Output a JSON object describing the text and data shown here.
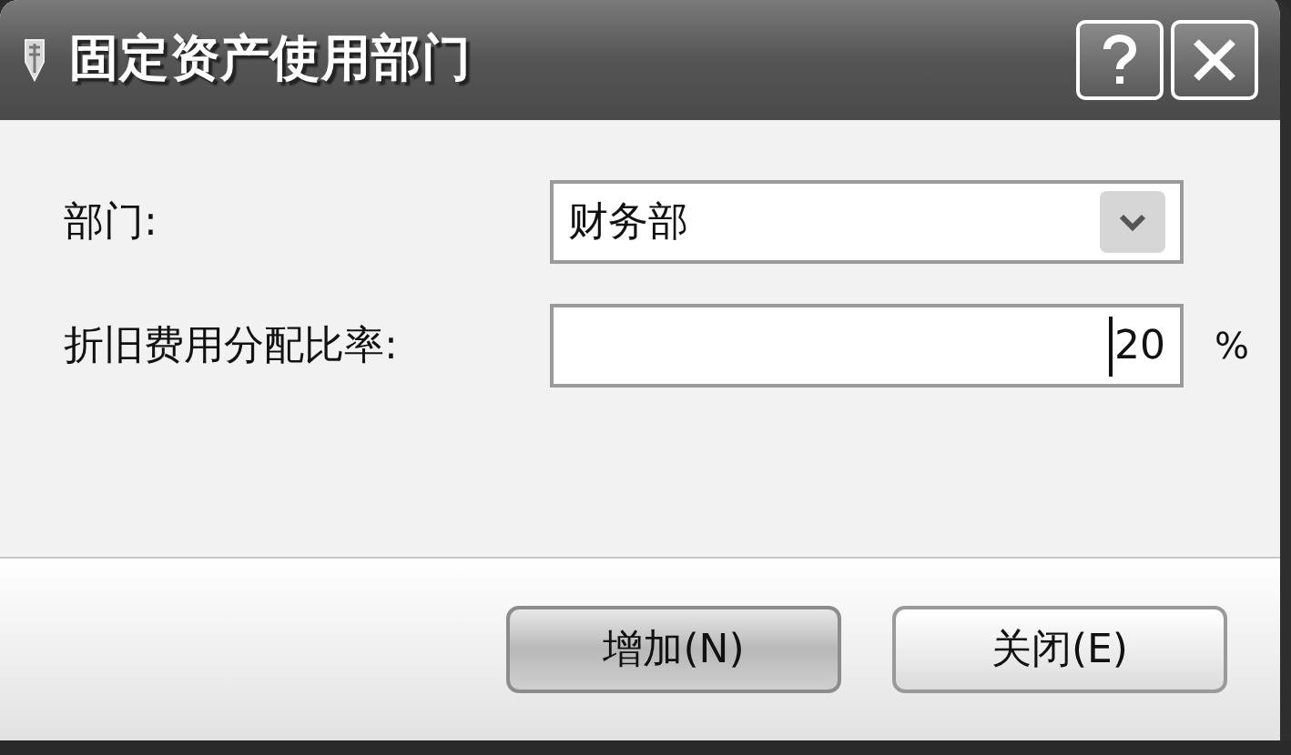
{
  "window": {
    "title": "固定资产使用部门"
  },
  "fields": [
    {
      "kind": "dropdown",
      "label": "部门:",
      "value": "财务部"
    },
    {
      "kind": "text",
      "label": "折旧费用分配比率:",
      "value": "20",
      "unit": "%"
    }
  ],
  "buttons": [
    {
      "label": "增加(N)",
      "default": true
    },
    {
      "label": "关闭(E)",
      "default": false
    }
  ]
}
